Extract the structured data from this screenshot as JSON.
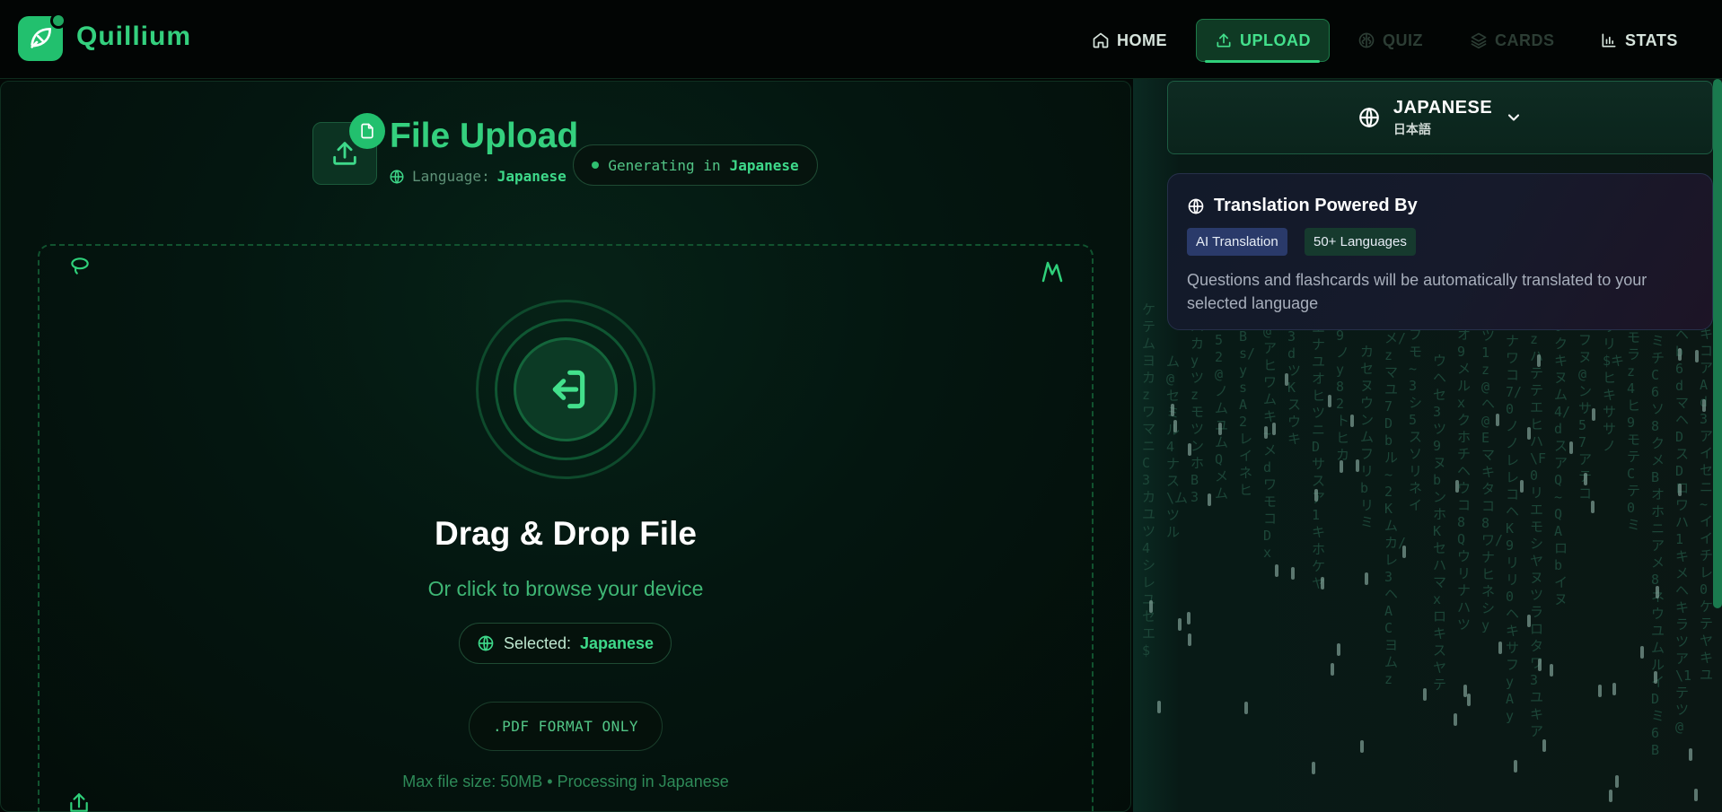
{
  "app": {
    "name": "Quillium"
  },
  "nav": {
    "home": "HOME",
    "upload": "UPLOAD",
    "quiz": "QUIZ",
    "cards": "CARDS",
    "stats": "STATS"
  },
  "upload": {
    "title": "File Upload",
    "language_label": "Language:",
    "language_value": "Japanese",
    "generating_prefix": "Generating in",
    "generating_lang": "Japanese",
    "dropzone_title": "Drag & Drop File",
    "dropzone_subtitle": "Or click to browse your device",
    "selected_label": "Selected:",
    "selected_value": "Japanese",
    "format_note": ".PDF FORMAT ONLY",
    "max_size_note": "Max file size: 50MB • Processing in Japanese"
  },
  "language_selector": {
    "name": "JAPANESE",
    "native": "日本語"
  },
  "translation_card": {
    "title": "Translation Powered By",
    "tags": [
      "AI Translation",
      "50+ Languages"
    ],
    "description": "Questions and flashcards will be automatically translated to your selected language"
  },
  "colors": {
    "accent": "#34d07e",
    "background": "#030806",
    "panel": "#041610"
  }
}
